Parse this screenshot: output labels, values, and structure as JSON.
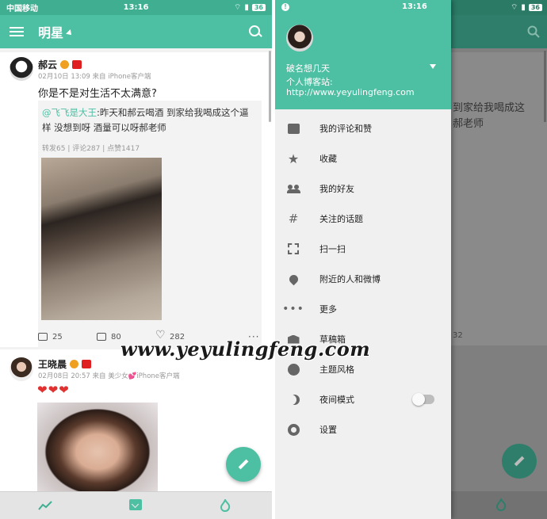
{
  "left": {
    "status": {
      "carrier": "中国移动",
      "time": "13:16",
      "battery": "36"
    },
    "appbar": {
      "title": "明星"
    },
    "posts": [
      {
        "user": "郝云",
        "meta": "02月10日 13:09 来自 iPhone客户端",
        "text": "你是不是对生活不太满意?",
        "repost": {
          "mention": "@飞飞是大王",
          "text": ":昨天和郝云喝酒 到家给我喝成这个逼样 没想到呀 酒量可以呀郝老师",
          "stats": "转发65 | 评论287 | 点赞1417"
        },
        "actions": {
          "reposts": "25",
          "comments": "80",
          "likes": "282",
          "more": "···"
        }
      },
      {
        "user": "王晓晨",
        "meta": "02月08日 20:57 来自 美少女💕iPhone客户端",
        "text": "❤❤❤"
      }
    ]
  },
  "watermark": "www.yeyulingfeng.com",
  "right": {
    "status": {
      "time": "13:16",
      "battery": "36"
    },
    "background_text": "到家给我喝成这\n郝老师",
    "background_count": "32",
    "drawer": {
      "status_dot": "!",
      "user_name": "破名想几天",
      "blog_label": "个人博客站:",
      "blog_url": "http://www.yeyulingfeng.com",
      "menu": [
        {
          "label": "我的评论和赞",
          "icon": "comment-icon"
        },
        {
          "label": "收藏",
          "icon": "star-icon"
        },
        {
          "label": "我的好友",
          "icon": "people-icon"
        },
        {
          "label": "关注的话题",
          "icon": "hashtag-icon"
        },
        {
          "label": "扫一扫",
          "icon": "scan-icon"
        },
        {
          "label": "附近的人和微博",
          "icon": "location-pin-icon"
        },
        {
          "label": "更多",
          "icon": "more-dots-icon"
        },
        {
          "label": "草稿箱",
          "icon": "drafts-icon"
        },
        {
          "label": "主题风格",
          "icon": "palette-icon"
        },
        {
          "label": "夜间模式",
          "icon": "night-mode-icon"
        },
        {
          "label": "设置",
          "icon": "settings-gear-icon"
        }
      ]
    }
  },
  "colors": {
    "accent": "#4dbfa2",
    "accent_dark": "#3fae91",
    "drawer_bg": "#f0f0f0"
  }
}
